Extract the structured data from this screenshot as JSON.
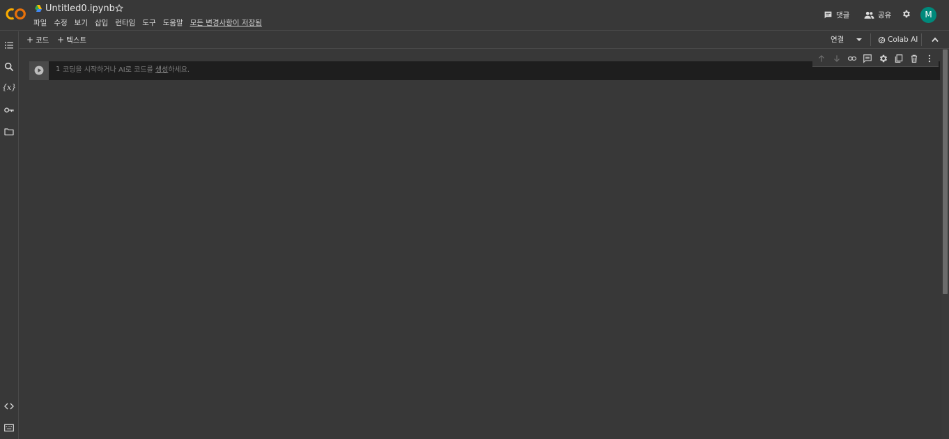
{
  "header": {
    "title": "Untitled0.ipynb",
    "menu": [
      "파일",
      "수정",
      "보기",
      "삽입",
      "런타임",
      "도구",
      "도움말"
    ],
    "save_status": "모든 변경사항이 저장됨",
    "comment_label": "댓글",
    "share_label": "공유",
    "avatar_letter": "M"
  },
  "toolbar": {
    "add_code_label": "코드",
    "add_text_label": "텍스트",
    "connect_label": "연결",
    "colab_ai_label": "Colab AI"
  },
  "cell": {
    "line_number": "1",
    "placeholder_before": "코딩을 시작하거나 AI로 코드를 ",
    "placeholder_link": "생성",
    "placeholder_after": "하세요."
  },
  "colors": {
    "background": "#383838",
    "cell_background": "#1e1e1e",
    "logo_orange": "#f9ab00",
    "avatar": "#00897b"
  },
  "icons": {
    "rail": [
      "table-of-contents-icon",
      "search-icon",
      "variables-icon",
      "secrets-key-icon",
      "folder-icon",
      "code-snippets-icon",
      "terminal-icon"
    ],
    "cell_toolbar": [
      "move-up-icon",
      "move-down-icon",
      "link-icon",
      "comment-icon",
      "settings-icon",
      "mirror-cell-icon",
      "delete-icon",
      "more-icon"
    ]
  }
}
